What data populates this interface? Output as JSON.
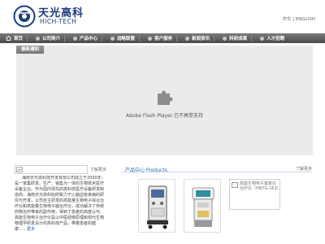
{
  "header": {
    "logo_cn": "天光高科",
    "logo_en": "HICH-TECH",
    "lang_cn": "中文",
    "lang_sep": "|",
    "lang_en": "ENGLISH"
  },
  "nav": {
    "items": [
      {
        "label": "首页"
      },
      {
        "label": "公司简介"
      },
      {
        "label": "产品中心"
      },
      {
        "label": "战略联盟"
      },
      {
        "label": "客户服务"
      },
      {
        "label": "新闻资讯"
      },
      {
        "label": "科研成果"
      },
      {
        "label": "人才招聘"
      }
    ]
  },
  "banner": {
    "tab_label": "最新通知",
    "plugin_text": "Adobe Flash Player 已不再受支持"
  },
  "about": {
    "more": "了解更多",
    "text": "海南天光高科技开发有限公司成立于2000年，是一家集研发、生产、销售为一体的生物技术医疗设备企业。作为国内领先的高科技医疗设备研发制造商，海南天光高科始终致力于心脑血管疾病的研究与开发，公司自主研发的高能量生物电子综合治疗仪和高能量生物电子脑治疗仪，成功解决了传统药物治疗带来的副作用，得到了患者的高度认可。高能生物电子治疗仪是以中医经络原理和现代生物物理学研发设计的高科技产品，带着患者的健康",
    "link": "更多"
  },
  "products": {
    "title": "产品中心 Products",
    "more": "了解更多",
    "broken_label": "高能生物电子康复仪治疗仪（HNTG-163）"
  },
  "colors": {
    "nav_bg": "#5a5a5a",
    "brand_blue": "#1d3c7a",
    "link_blue": "#2c6bb5",
    "banner_bg": "#ebebeb"
  }
}
